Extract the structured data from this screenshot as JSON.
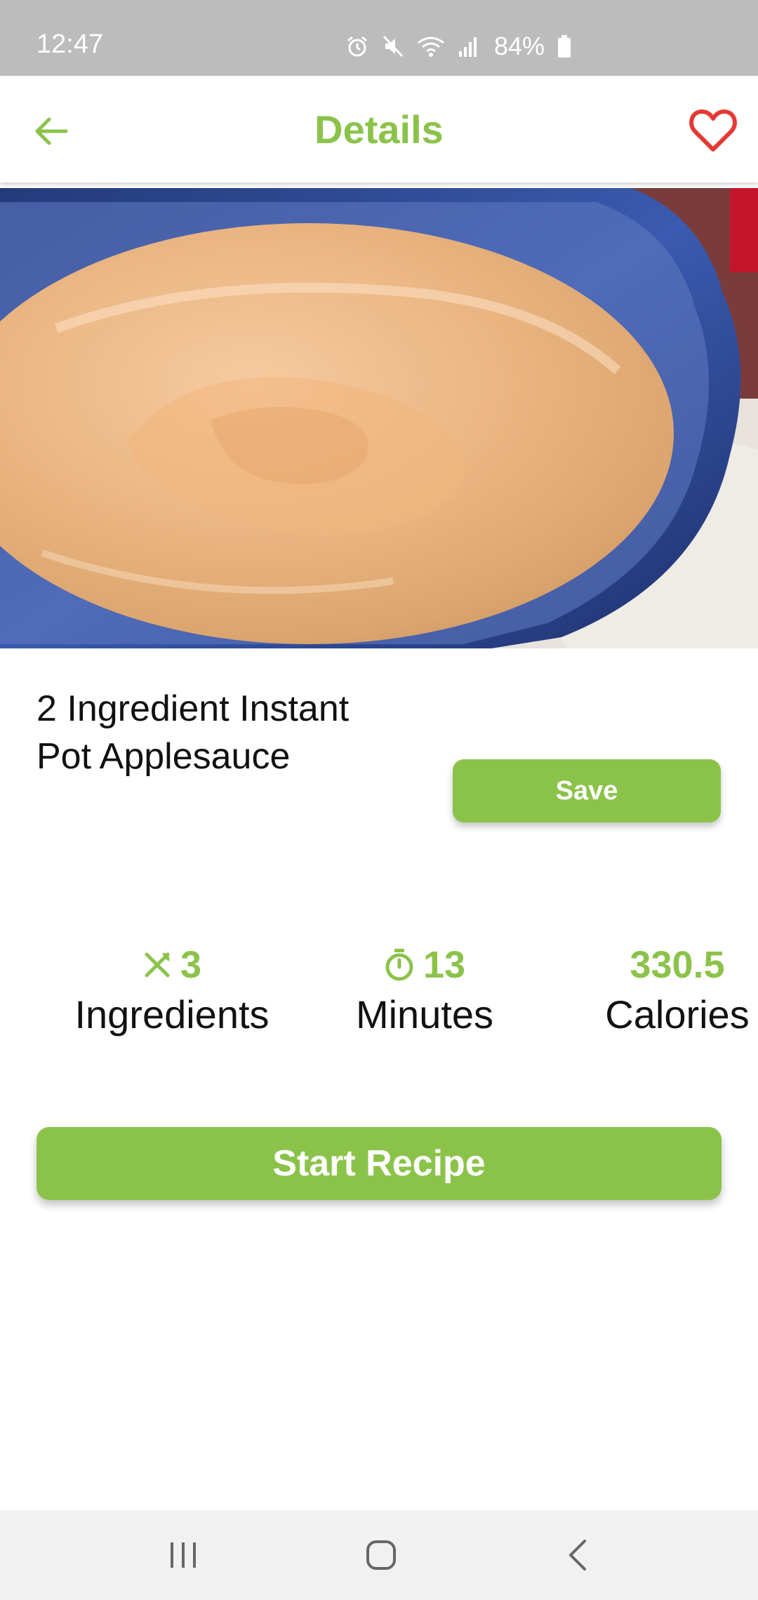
{
  "status_bar": {
    "time": "12:47",
    "battery_percent": "84%",
    "icons": [
      "alarm-icon",
      "mute-icon",
      "wifi-icon",
      "signal-icon",
      "battery-icon"
    ]
  },
  "app_bar": {
    "title": "Details",
    "back_icon": "arrow-left-icon",
    "favorite_icon": "heart-outline-icon"
  },
  "hero": {
    "image_subject": "applesauce-in-blue-bowl"
  },
  "recipe": {
    "title_line1": "2 Ingredient Instant",
    "title_line2": "Pot Applesauce",
    "save_label": "Save"
  },
  "stats": {
    "ingredients": {
      "value": "3",
      "label": "Ingredients",
      "icon": "utensils-icon"
    },
    "minutes": {
      "value": "13",
      "label": "Minutes",
      "icon": "timer-icon"
    },
    "calories": {
      "value": "330.5",
      "label": "Calories"
    }
  },
  "actions": {
    "start_label": "Start Recipe"
  },
  "nav_bar": {
    "items": [
      "recent-apps-icon",
      "home-icon",
      "back-icon"
    ]
  },
  "colors": {
    "accent": "#8bc34a",
    "favorite": "#e53935",
    "status_bar": "#bcbcbc",
    "nav_bar": "#f1f1f1"
  }
}
